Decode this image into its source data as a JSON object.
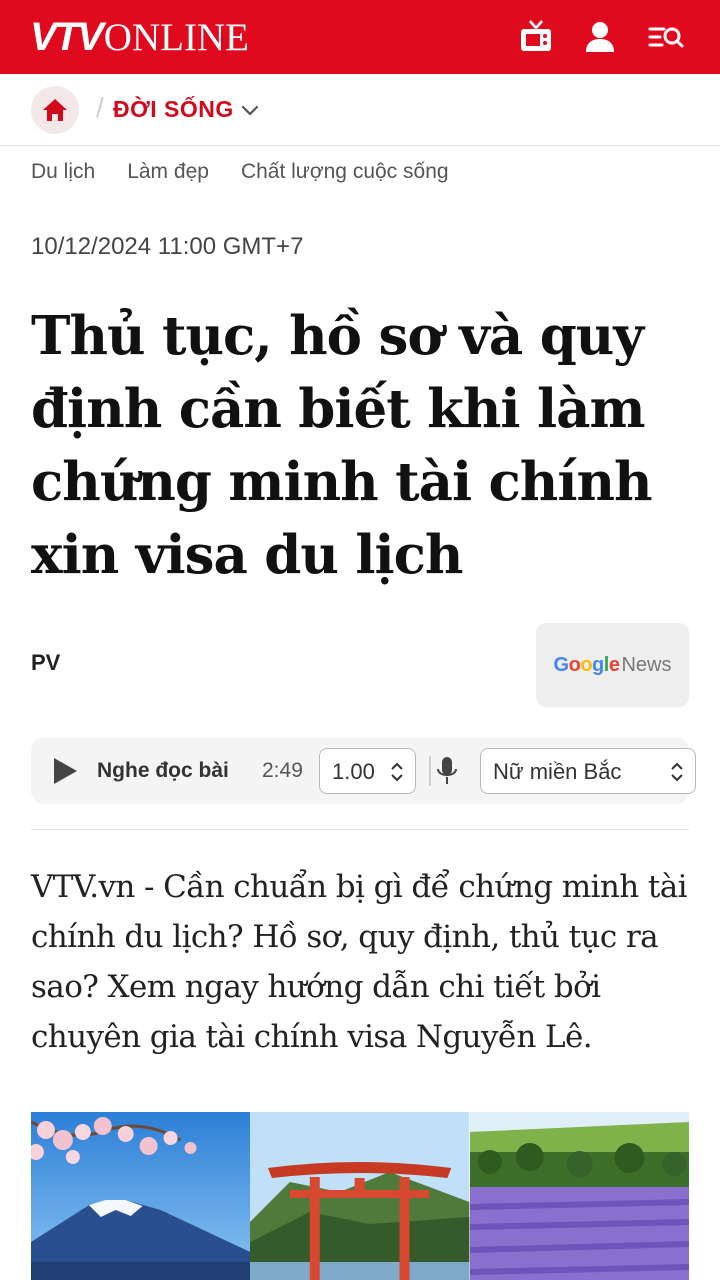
{
  "header": {
    "logo_vtv": "VTV",
    "logo_online": "ONLINE",
    "brand_color": "#e00a1e",
    "icons": [
      "tv-icon",
      "user-icon",
      "search-menu-icon"
    ]
  },
  "breadcrumb": {
    "home_icon": "home-icon",
    "section": "ĐỜI SỐNG"
  },
  "subnav": {
    "items": [
      "Du lịch",
      "Làm đẹp",
      "Chất lượng cuộc sống"
    ]
  },
  "article": {
    "date": "10/12/2024 11:00 GMT+7",
    "title": "Thủ tục, hồ sơ và quy định cần biết khi làm chứng minh tài chính xin visa du lịch",
    "author": "PV",
    "google_news_label_a": "Google",
    "google_news_label_b": "News",
    "lead": "VTV.vn - Cần chuẩn bị gì để chứng minh tài chính du lịch? Hồ sơ, quy định, thủ tục ra sao? Xem ngay hướng dẫn chi tiết bởi chuyên gia tài chính visa Nguyễn Lê."
  },
  "player": {
    "listen_label": "Nghe đọc bài",
    "duration": "2:49",
    "speed": "1.00",
    "voice": "Nữ miền Bắc"
  },
  "images": [
    "mount-fuji-cherry-blossom",
    "torii-gate",
    "lavender-field"
  ]
}
